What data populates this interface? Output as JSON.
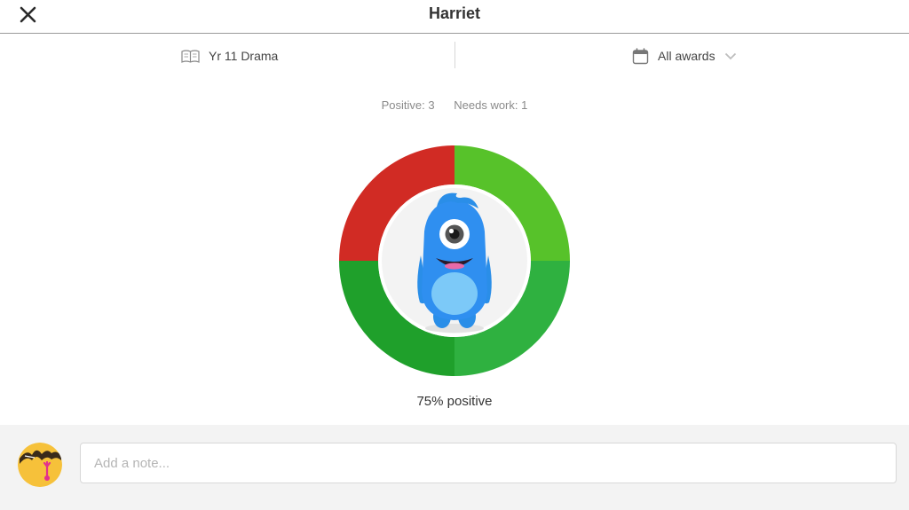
{
  "header": {
    "title": "Harriet",
    "close_icon": "close-icon"
  },
  "filters": {
    "class_icon": "book-icon",
    "class_label": "Yr 11 Drama",
    "awards_icon": "calendar-icon",
    "awards_label": "All awards",
    "awards_chevron_icon": "chevron-down-icon"
  },
  "stats": {
    "positive_label": "Positive: 3",
    "needs_work_label": "Needs work: 1",
    "positive_count": 3,
    "needs_work_count": 1,
    "percent_label": "75% positive",
    "ring_colors": [
      "#57c22a",
      "#2fb140",
      "#1fa02b",
      "#d12b24"
    ],
    "ring_segments": [
      "positive",
      "positive",
      "positive",
      "needs_work"
    ]
  },
  "note": {
    "placeholder": "Add a note..."
  },
  "colors": {
    "accent_green": "#57c22a",
    "needs_work_red": "#d12b24",
    "footer_bg": "#f3f3f3"
  }
}
